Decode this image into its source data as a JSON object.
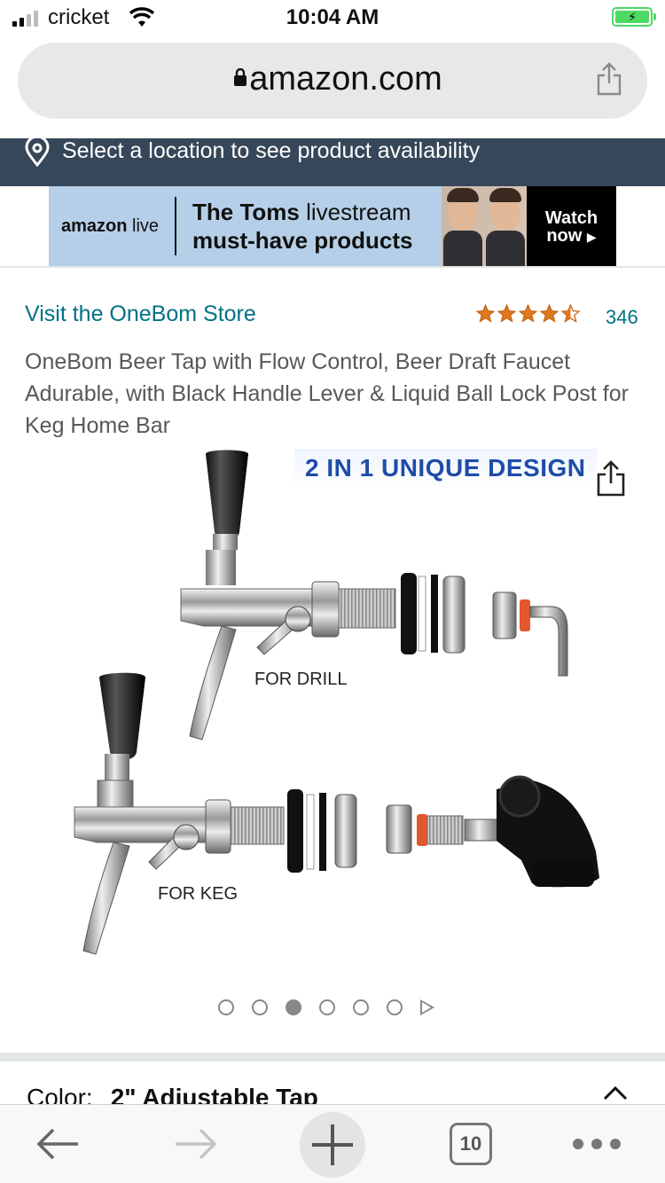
{
  "status": {
    "carrier": "cricket",
    "time": "10:04 AM",
    "battery_icon": "charging-battery-icon"
  },
  "browser": {
    "url": "amazon.com",
    "tab_count": "10"
  },
  "location": {
    "text": "Select a location to see product availability"
  },
  "banner": {
    "brand": "amazon",
    "brand_suffix": "live",
    "line1_bold": "The Toms",
    "line1_rest": " livestream",
    "line2": "must-have products",
    "watch": "Watch",
    "now": "now"
  },
  "product": {
    "store_link": "Visit the OneBom Store",
    "rating": 4.5,
    "review_count": "346",
    "title": "OneBom Beer Tap with Flow Control, Beer Draft Faucet Adurable, with Black Handle Lever & Liquid Ball Lock Post for Keg Home Bar",
    "image_headline": "2 IN 1 UNIQUE DESIGN",
    "label_drill": "FOR DRILL",
    "label_keg": "FOR KEG",
    "image_count": 6,
    "active_image_index": 2,
    "color_label": "Color:",
    "color_value": "2\" Adjustable Tap"
  },
  "colors": {
    "link": "#007185",
    "location_bar": "#37475a",
    "star": "#de7921",
    "headline": "#1e4ca8"
  }
}
